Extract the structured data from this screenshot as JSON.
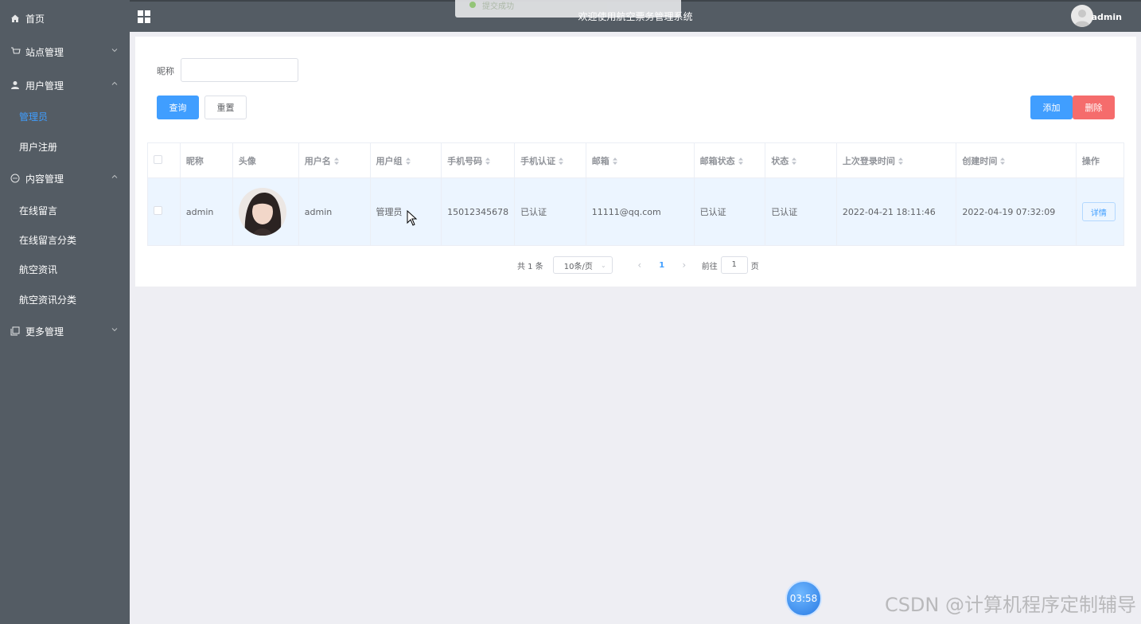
{
  "sidebar": {
    "items": [
      {
        "label": "首页",
        "icon": "home-icon"
      },
      {
        "label": "站点管理",
        "icon": "cart-icon"
      },
      {
        "label": "用户管理",
        "icon": "user-icon"
      },
      {
        "label": "内容管理",
        "icon": "chat-icon"
      },
      {
        "label": "更多管理",
        "icon": "copy-icon"
      }
    ],
    "user_sub": [
      {
        "label": "管理员"
      },
      {
        "label": "用户注册"
      }
    ],
    "content_sub": [
      {
        "label": "在线留言"
      },
      {
        "label": "在线留言分类"
      },
      {
        "label": "航空资讯"
      },
      {
        "label": "航空资讯分类"
      }
    ]
  },
  "header": {
    "title": "欢迎使用航空票务管理系统",
    "user": "admin",
    "toast": "提交成功"
  },
  "search": {
    "label": "昵称",
    "value": "",
    "query_label": "查询",
    "reset_label": "重置"
  },
  "toolbar": {
    "add_label": "添加",
    "delete_label": "删除"
  },
  "table": {
    "columns": [
      "昵称",
      "头像",
      "用户名",
      "用户组",
      "手机号码",
      "手机认证",
      "邮箱",
      "邮箱状态",
      "状态",
      "上次登录时间",
      "创建时间",
      "操作"
    ],
    "rows": [
      {
        "nickname": "admin",
        "username": "admin",
        "group": "管理员",
        "phone": "15012345678",
        "phone_verified": "已认证",
        "email": "11111@qq.com",
        "email_status": "已认证",
        "status": "已认证",
        "last_login": "2022-04-21 18:11:46",
        "created": "2022-04-19 07:32:09",
        "action": "详情"
      }
    ]
  },
  "pagination": {
    "total": "共 1 条",
    "page_size": "10条/页",
    "current": "1",
    "goto_prefix": "前往",
    "goto_value": "1",
    "goto_suffix": "页"
  },
  "overlay": {
    "timer": "03:58",
    "watermark": "CSDN @计算机程序定制辅导"
  },
  "colors": {
    "sidebar_bg": "#545c64",
    "primary": "#409eff",
    "danger": "#f56c6c",
    "page_bg": "#eeeef3"
  }
}
